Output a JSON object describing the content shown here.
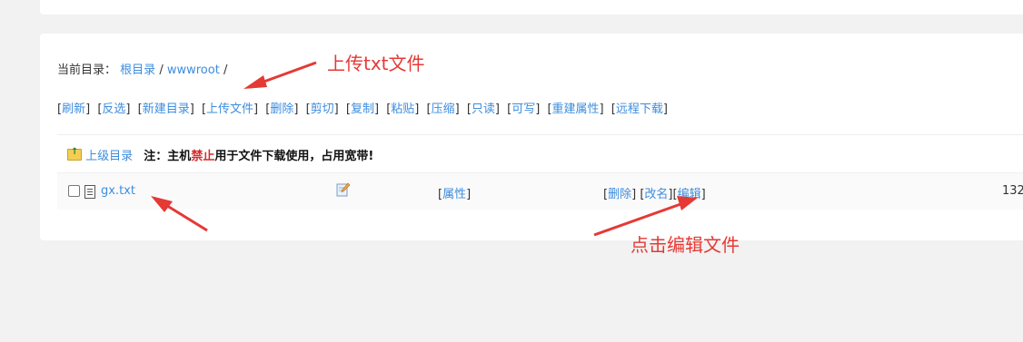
{
  "breadcrumb": {
    "prefix": "当前目录：",
    "items": [
      "根目录",
      "wwwroot"
    ],
    "separator": "/"
  },
  "toolbar": {
    "buttons": [
      "刷新",
      "反选",
      "新建目录",
      "上传文件",
      "删除",
      "剪切",
      "复制",
      "粘贴",
      "压缩",
      "只读",
      "可写",
      "重建属性",
      "远程下载"
    ]
  },
  "parent_row": {
    "label": "上级目录",
    "note_prefix": "注：主机",
    "note_red": "禁止",
    "note_suffix": "用于文件下载使用，占用宽带!"
  },
  "file_row": {
    "name": "gx.txt",
    "attr": "属性",
    "ops": [
      "删除",
      "改名",
      "编辑"
    ],
    "size": "132"
  },
  "annotations": {
    "upload": "上传txt文件",
    "edit": "点击编辑文件"
  },
  "colors": {
    "link": "#3c8dde",
    "annotation": "#e53935",
    "warning": "#d62b2b"
  }
}
